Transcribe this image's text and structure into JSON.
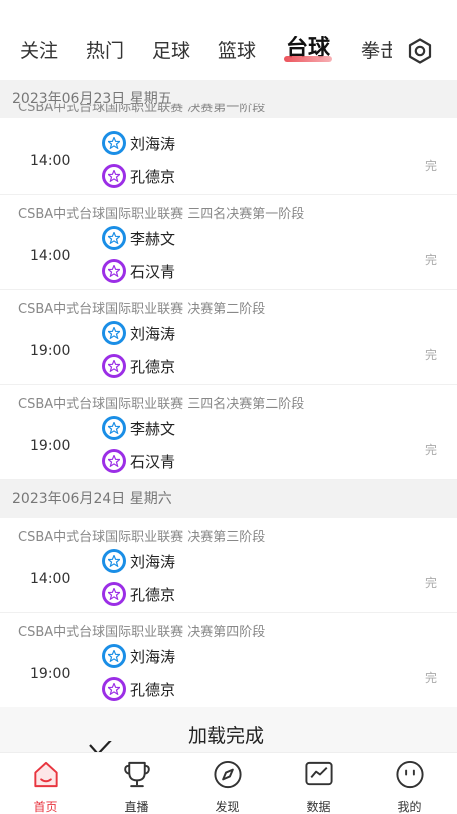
{
  "tabs": [
    {
      "label": "关注"
    },
    {
      "label": "热门"
    },
    {
      "label": "足球"
    },
    {
      "label": "篮球"
    },
    {
      "label": "台球",
      "active": true
    },
    {
      "label": "拳击"
    }
  ],
  "sections": [
    {
      "date": "2023年06月23日  星期五",
      "matches": [
        {
          "title": "CSBA中式台球国际职业联赛 决赛第一阶段",
          "time": "14:00",
          "player1": "刘海涛",
          "player2": "孔德京",
          "status": "完"
        },
        {
          "title": "CSBA中式台球国际职业联赛 三四名决赛第一阶段",
          "time": "14:00",
          "player1": "李赫文",
          "player2": "石汉青",
          "status": "完"
        },
        {
          "title": "CSBA中式台球国际职业联赛 决赛第二阶段",
          "time": "19:00",
          "player1": "刘海涛",
          "player2": "孔德京",
          "status": "完"
        },
        {
          "title": "CSBA中式台球国际职业联赛 三四名决赛第二阶段",
          "time": "19:00",
          "player1": "李赫文",
          "player2": "石汉青",
          "status": "完"
        }
      ]
    },
    {
      "date": "2023年06月24日  星期六",
      "matches": [
        {
          "title": "CSBA中式台球国际职业联赛 决赛第三阶段",
          "time": "14:00",
          "player1": "刘海涛",
          "player2": "孔德京",
          "status": "完"
        },
        {
          "title": "CSBA中式台球国际职业联赛 决赛第四阶段",
          "time": "19:00",
          "player1": "刘海涛",
          "player2": "孔德京",
          "status": "完"
        }
      ]
    }
  ],
  "load_status": "加载完成",
  "bottom_nav": [
    {
      "label": "首页",
      "icon": "home-icon",
      "active": true
    },
    {
      "label": "直播",
      "icon": "trophy-icon"
    },
    {
      "label": "发现",
      "icon": "compass-icon"
    },
    {
      "label": "数据",
      "icon": "chart-icon"
    },
    {
      "label": "我的",
      "icon": "profile-icon"
    }
  ],
  "colors": {
    "accent": "#e8353f",
    "player_blue": "#1a8ee6",
    "player_purple": "#9b2ee6",
    "date_header_bg": "#f2f2f2"
  }
}
